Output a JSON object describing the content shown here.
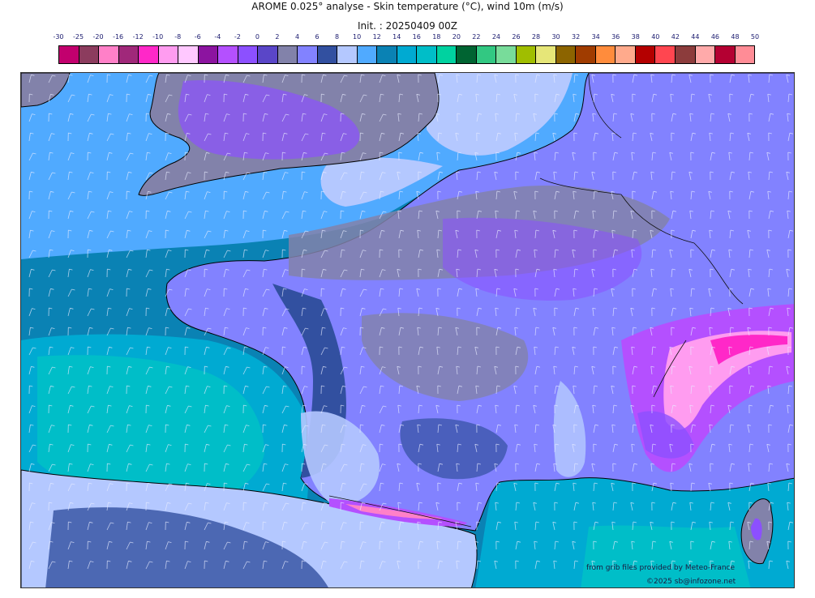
{
  "header": {
    "title": "AROME 0.025° analyse - Skin temperature (°C), wind 10m (m/s)",
    "init": "Init. : 20250409 00Z"
  },
  "legend": {
    "ticks": [
      "-30",
      "-25",
      "-20",
      "-16",
      "-12",
      "-10",
      "-8",
      "-6",
      "-4",
      "-2",
      "0",
      "2",
      "4",
      "6",
      "8",
      "10",
      "12",
      "14",
      "16",
      "18",
      "20",
      "22",
      "24",
      "26",
      "28",
      "30",
      "32",
      "34",
      "36",
      "38",
      "40",
      "42",
      "44",
      "46",
      "48",
      "50"
    ],
    "colors": [
      "#c2006e",
      "#8c3c5e",
      "#ff80c8",
      "#a0287a",
      "#ff28c8",
      "#ff9cf0",
      "#ffc8ff",
      "#8c14a0",
      "#b450ff",
      "#8c50ff",
      "#5a46c8",
      "#8282aa",
      "#8282ff",
      "#3250a0",
      "#b4c8ff",
      "#50aaff",
      "#0a82b4",
      "#00aad2",
      "#00bec8",
      "#00d2a0",
      "#006432",
      "#32c882",
      "#78dc9a",
      "#a0be00",
      "#e6e678",
      "#8c6400",
      "#a03c00",
      "#ff8c3c",
      "#ffaa8c",
      "#b40000",
      "#ff4650",
      "#8c3c3c",
      "#ffaaaa",
      "#b40032",
      "#ff8c96"
    ]
  },
  "map": {
    "colors": {
      "sea_deep": "#0a82b4",
      "sea_mid": "#00aad2",
      "sea_light": "#00bec8",
      "channel": "#50aaff",
      "cold_pale": "#b4c8ff",
      "land_base": "#8282aa",
      "land_blue": "#8282ff",
      "land_dark": "#3250a0",
      "land_purple": "#8c50ff",
      "alps_violet": "#b450ff",
      "alps_pink": "#ff9cf0",
      "pyrenees_pink": "#ff80c8",
      "coast": "#000000",
      "barb": "#e8ecff"
    }
  },
  "credits": {
    "source": "from grib files provided by Meteo-France",
    "copyright": "©2025 sb@infozone.net"
  }
}
